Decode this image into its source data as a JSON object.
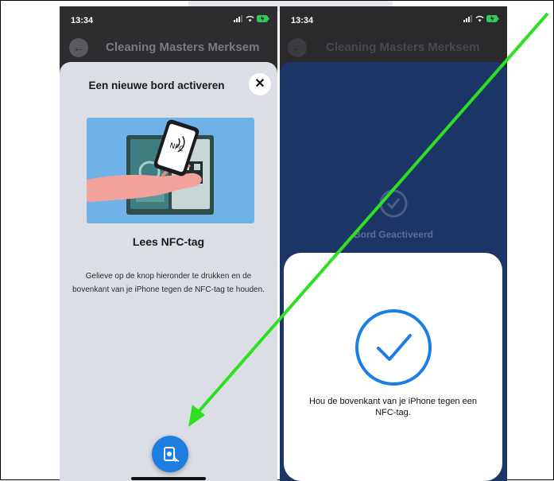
{
  "left_screen": {
    "status_time": "13:34",
    "app_title": "Cleaning Masters Merksem",
    "sheet_title": "Een nieuwe bord activeren",
    "illustration_nfc_text": "NFC",
    "heading": "Lees NFC-tag",
    "description": "Gelieve op de knop hieronder te drukken en de bovenkant van je iPhone tegen de NFC-tag te houden.",
    "close_label": "✕",
    "back_label": "←"
  },
  "right_screen": {
    "status_time": "13:34",
    "app_title": "Cleaning Masters Merksem",
    "done_label": "Bord Geactiveerd",
    "nfc_message": "Hou de bovenkant van je iPhone tegen een NFC-tag.",
    "back_label": "←"
  },
  "colors": {
    "button_blue": "#1d7de0",
    "sheet_navy": "#1b3566",
    "arrow_green": "#2ee022",
    "check_blue": "#1a7ee6"
  },
  "icons": [
    "back-arrow-icon",
    "close-icon",
    "nfc-icon",
    "check-circle-icon",
    "signal-icon",
    "wifi-icon",
    "battery-icon"
  ]
}
